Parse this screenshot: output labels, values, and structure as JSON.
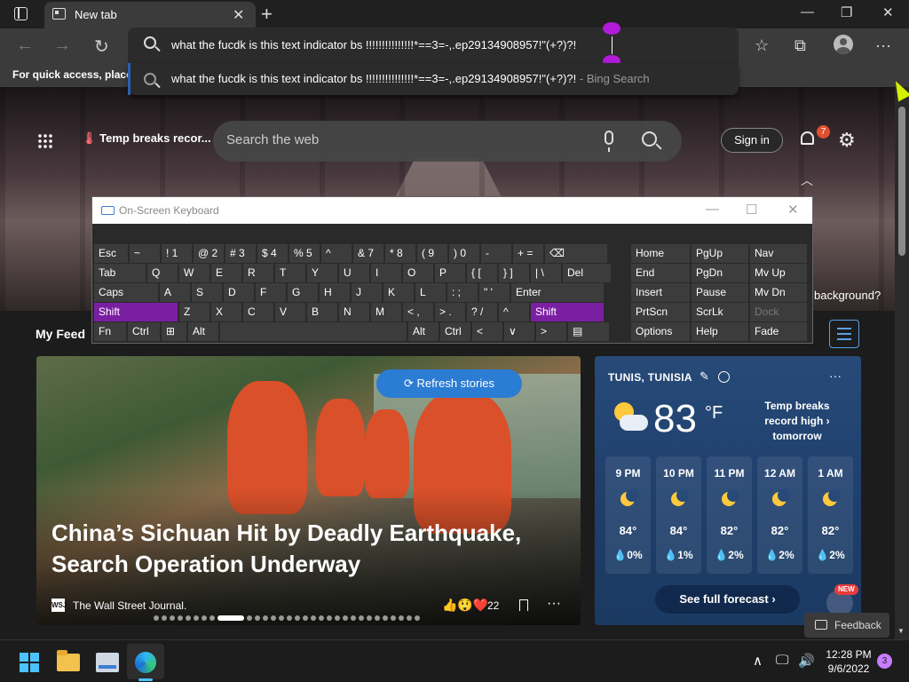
{
  "browser": {
    "tab_title": "New tab",
    "close_glyph": "✕",
    "new_tab_glyph": "+",
    "nav_back": "←",
    "nav_forward": "→",
    "nav_refresh": "↻",
    "favorites_glyph": "☆",
    "collections_glyph": "⧉",
    "menu_glyph": "···",
    "minimize": "—",
    "maximize": "❐",
    "close": "✕",
    "favorites_bar_text": "For quick access, place y"
  },
  "omnibox": {
    "query": "what the fucdk is this text indicator bs !!!!!!!!!!!!!!!*==3=-,.ep29134908957!\"(+?)?!",
    "suggestion_text": "what the fucdk is this text indicator bs !!!!!!!!!!!!!!!*==3=-,.ep29134908957!\"(+?)?!",
    "suggestion_suffix": " - Bing Search"
  },
  "newtab": {
    "temp_chip": "Temp breaks recor...",
    "search_placeholder": "Search the web",
    "signin": "Sign in",
    "notification_count": "7",
    "background_question": "background?",
    "my_feed": "My Feed"
  },
  "story": {
    "headline": "China’s Sichuan Hit by Deadly Earthquake, Search Operation Underway",
    "source": "The Wall Street Journal.",
    "source_logo": "WSJ",
    "reaction_emojis": "👍😲❤️",
    "reaction_count": "22",
    "more": "···",
    "refresh_label": "⟳ Refresh stories"
  },
  "weather": {
    "city": "TUNIS, TUNISIA",
    "temperature": "83",
    "unit": "°F",
    "alert": "Temp breaks record high › tomorrow",
    "more": "···",
    "hours": [
      {
        "time": "9 PM",
        "temp": "84°",
        "precip": "💧0%"
      },
      {
        "time": "10 PM",
        "temp": "84°",
        "precip": "💧1%"
      },
      {
        "time": "11 PM",
        "temp": "82°",
        "precip": "💧2%"
      },
      {
        "time": "12 AM",
        "temp": "82°",
        "precip": "💧2%"
      },
      {
        "time": "1 AM",
        "temp": "82°",
        "precip": "💧2%"
      }
    ],
    "forecast_button": "See full forecast ›",
    "new_badge": "NEW"
  },
  "feedback": "Feedback",
  "osk": {
    "title": "On-Screen Keyboard",
    "keys": [
      [
        "Esc",
        "~",
        "!  1",
        "@  2",
        "#  3",
        "$  4",
        "%  5",
        "^",
        "&  7",
        "*  8",
        "(  9",
        ")  0",
        "-",
        "+  =",
        "⌫"
      ],
      [
        "Tab",
        "Q",
        "W",
        "E",
        "R",
        "T",
        "Y",
        "U",
        "I",
        "O",
        "P",
        "{  [",
        "}  ]",
        "|  \\",
        "Del"
      ],
      [
        "Caps",
        "A",
        "S",
        "D",
        "F",
        "G",
        "H",
        "J",
        "K",
        "L",
        ":  ;",
        "\"  '",
        "Enter"
      ],
      [
        "Shift",
        "Z",
        "X",
        "C",
        "V",
        "B",
        "N",
        "M",
        "<  ,",
        ">  .",
        "?  /",
        "^",
        "Shift"
      ],
      [
        "Fn",
        "Ctrl",
        "⊞",
        "Alt",
        "",
        "Alt",
        "Ctrl",
        "<",
        "∨",
        ">",
        "▤"
      ]
    ],
    "side_keys": [
      [
        "Home",
        "PgUp",
        "Nav"
      ],
      [
        "End",
        "PgDn",
        "Mv Up"
      ],
      [
        "Insert",
        "Pause",
        "Mv Dn"
      ],
      [
        "PrtScn",
        "ScrLk",
        "Dock"
      ],
      [
        "Options",
        "Help",
        "Fade"
      ]
    ]
  },
  "taskbar": {
    "time": "12:28 PM",
    "date": "9/6/2022",
    "notification_count": "3",
    "tray_up": "∧",
    "tray_network": "🖵",
    "tray_volume": "🔊"
  }
}
